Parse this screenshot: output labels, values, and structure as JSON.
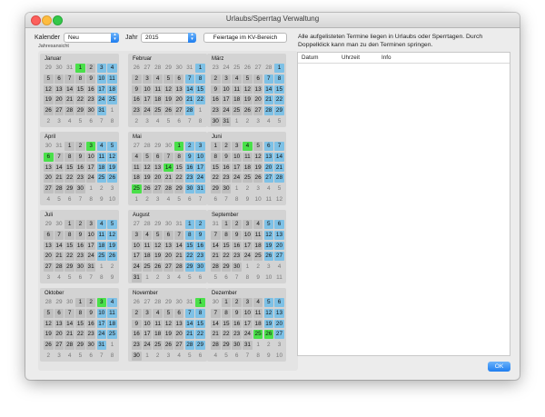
{
  "window": {
    "title": "Urlaubs/Sperrtag Verwaltung"
  },
  "toolbar": {
    "kalender_label": "Kalender",
    "kalender_value": "Neu",
    "jahr_label": "Jahr",
    "jahr_value": "2015",
    "feiertage_button": "Feiertage im KV-Bereich"
  },
  "jahresansicht_label": "Jahresansicht",
  "colors": {
    "weekend": "#7ec1e6",
    "holiday": "#4ae04a",
    "day": "#bfbfbf",
    "accent": "#1e7ef0"
  },
  "months": [
    {
      "name": "Januar",
      "weeks": [
        [
          "29",
          "30",
          "31",
          "1",
          "2",
          "3",
          "4"
        ],
        [
          "5",
          "6",
          "7",
          "8",
          "9",
          "10",
          "11"
        ],
        [
          "12",
          "13",
          "14",
          "15",
          "16",
          "17",
          "18"
        ],
        [
          "19",
          "20",
          "21",
          "22",
          "23",
          "24",
          "25"
        ],
        [
          "26",
          "27",
          "28",
          "29",
          "30",
          "31",
          "1"
        ],
        [
          "2",
          "3",
          "4",
          "5",
          "6",
          "7",
          "8"
        ]
      ],
      "holidays": [
        "1"
      ]
    },
    {
      "name": "Februar",
      "weeks": [
        [
          "26",
          "27",
          "28",
          "29",
          "30",
          "31",
          "1"
        ],
        [
          "2",
          "3",
          "4",
          "5",
          "6",
          "7",
          "8"
        ],
        [
          "9",
          "10",
          "11",
          "12",
          "13",
          "14",
          "15"
        ],
        [
          "16",
          "17",
          "18",
          "19",
          "20",
          "21",
          "22"
        ],
        [
          "23",
          "24",
          "25",
          "26",
          "27",
          "28",
          "1"
        ],
        [
          "2",
          "3",
          "4",
          "5",
          "6",
          "7",
          "8"
        ]
      ],
      "holidays": []
    },
    {
      "name": "März",
      "weeks": [
        [
          "23",
          "24",
          "25",
          "26",
          "27",
          "28",
          "1"
        ],
        [
          "2",
          "3",
          "4",
          "5",
          "6",
          "7",
          "8"
        ],
        [
          "9",
          "10",
          "11",
          "12",
          "13",
          "14",
          "15"
        ],
        [
          "16",
          "17",
          "18",
          "19",
          "20",
          "21",
          "22"
        ],
        [
          "23",
          "24",
          "25",
          "26",
          "27",
          "28",
          "29"
        ],
        [
          "30",
          "31",
          "1",
          "2",
          "3",
          "4",
          "5"
        ]
      ],
      "holidays": []
    },
    {
      "name": "April",
      "weeks": [
        [
          "30",
          "31",
          "1",
          "2",
          "3",
          "4",
          "5"
        ],
        [
          "6",
          "7",
          "8",
          "9",
          "10",
          "11",
          "12"
        ],
        [
          "13",
          "14",
          "15",
          "16",
          "17",
          "18",
          "19"
        ],
        [
          "20",
          "21",
          "22",
          "23",
          "24",
          "25",
          "26"
        ],
        [
          "27",
          "28",
          "29",
          "30",
          "1",
          "2",
          "3"
        ],
        [
          "4",
          "5",
          "6",
          "7",
          "8",
          "9",
          "10"
        ]
      ],
      "holidays": [
        "3",
        "6"
      ]
    },
    {
      "name": "Mai",
      "weeks": [
        [
          "27",
          "28",
          "29",
          "30",
          "1",
          "2",
          "3"
        ],
        [
          "4",
          "5",
          "6",
          "7",
          "8",
          "9",
          "10"
        ],
        [
          "11",
          "12",
          "13",
          "14",
          "15",
          "16",
          "17"
        ],
        [
          "18",
          "19",
          "20",
          "21",
          "22",
          "23",
          "24"
        ],
        [
          "25",
          "26",
          "27",
          "28",
          "29",
          "30",
          "31"
        ],
        [
          "1",
          "2",
          "3",
          "4",
          "5",
          "6",
          "7"
        ]
      ],
      "holidays": [
        "1",
        "14",
        "25"
      ]
    },
    {
      "name": "Juni",
      "weeks": [
        [
          "1",
          "2",
          "3",
          "4",
          "5",
          "6",
          "7"
        ],
        [
          "8",
          "9",
          "10",
          "11",
          "12",
          "13",
          "14"
        ],
        [
          "15",
          "16",
          "17",
          "18",
          "19",
          "20",
          "21"
        ],
        [
          "22",
          "23",
          "24",
          "25",
          "26",
          "27",
          "28"
        ],
        [
          "29",
          "30",
          "1",
          "2",
          "3",
          "4",
          "5"
        ],
        [
          "6",
          "7",
          "8",
          "9",
          "10",
          "11",
          "12"
        ]
      ],
      "holidays": [
        "4"
      ]
    },
    {
      "name": "Juli",
      "weeks": [
        [
          "29",
          "30",
          "1",
          "2",
          "3",
          "4",
          "5"
        ],
        [
          "6",
          "7",
          "8",
          "9",
          "10",
          "11",
          "12"
        ],
        [
          "13",
          "14",
          "15",
          "16",
          "17",
          "18",
          "19"
        ],
        [
          "20",
          "21",
          "22",
          "23",
          "24",
          "25",
          "26"
        ],
        [
          "27",
          "28",
          "29",
          "30",
          "31",
          "1",
          "2"
        ],
        [
          "3",
          "4",
          "5",
          "6",
          "7",
          "8",
          "9"
        ]
      ],
      "holidays": []
    },
    {
      "name": "August",
      "weeks": [
        [
          "27",
          "28",
          "29",
          "30",
          "31",
          "1",
          "2"
        ],
        [
          "3",
          "4",
          "5",
          "6",
          "7",
          "8",
          "9"
        ],
        [
          "10",
          "11",
          "12",
          "13",
          "14",
          "15",
          "16"
        ],
        [
          "17",
          "18",
          "19",
          "20",
          "21",
          "22",
          "23"
        ],
        [
          "24",
          "25",
          "26",
          "27",
          "28",
          "29",
          "30"
        ],
        [
          "31",
          "1",
          "2",
          "3",
          "4",
          "5",
          "6"
        ]
      ],
      "holidays": []
    },
    {
      "name": "September",
      "weeks": [
        [
          "31",
          "1",
          "2",
          "3",
          "4",
          "5",
          "6"
        ],
        [
          "7",
          "8",
          "9",
          "10",
          "11",
          "12",
          "13"
        ],
        [
          "14",
          "15",
          "16",
          "17",
          "18",
          "19",
          "20"
        ],
        [
          "21",
          "22",
          "23",
          "24",
          "25",
          "26",
          "27"
        ],
        [
          "28",
          "29",
          "30",
          "1",
          "2",
          "3",
          "4"
        ],
        [
          "5",
          "6",
          "7",
          "8",
          "9",
          "10",
          "11"
        ]
      ],
      "holidays": []
    },
    {
      "name": "Oktober",
      "weeks": [
        [
          "28",
          "29",
          "30",
          "1",
          "2",
          "3",
          "4"
        ],
        [
          "5",
          "6",
          "7",
          "8",
          "9",
          "10",
          "11"
        ],
        [
          "12",
          "13",
          "14",
          "15",
          "16",
          "17",
          "18"
        ],
        [
          "19",
          "20",
          "21",
          "22",
          "23",
          "24",
          "25"
        ],
        [
          "26",
          "27",
          "28",
          "29",
          "30",
          "31",
          "1"
        ],
        [
          "2",
          "3",
          "4",
          "5",
          "6",
          "7",
          "8"
        ]
      ],
      "holidays": [
        "3"
      ]
    },
    {
      "name": "November",
      "weeks": [
        [
          "26",
          "27",
          "28",
          "29",
          "30",
          "31",
          "1"
        ],
        [
          "2",
          "3",
          "4",
          "5",
          "6",
          "7",
          "8"
        ],
        [
          "9",
          "10",
          "11",
          "12",
          "13",
          "14",
          "15"
        ],
        [
          "16",
          "17",
          "18",
          "19",
          "20",
          "21",
          "22"
        ],
        [
          "23",
          "24",
          "25",
          "26",
          "27",
          "28",
          "29"
        ],
        [
          "30",
          "1",
          "2",
          "3",
          "4",
          "5",
          "6"
        ]
      ],
      "holidays": [
        "1"
      ]
    },
    {
      "name": "Dezember",
      "weeks": [
        [
          "30",
          "1",
          "2",
          "3",
          "4",
          "5",
          "6"
        ],
        [
          "7",
          "8",
          "9",
          "10",
          "11",
          "12",
          "13"
        ],
        [
          "14",
          "15",
          "16",
          "17",
          "18",
          "19",
          "20"
        ],
        [
          "21",
          "22",
          "23",
          "24",
          "25",
          "26",
          "27"
        ],
        [
          "28",
          "29",
          "30",
          "31",
          "1",
          "2",
          "3"
        ],
        [
          "4",
          "5",
          "6",
          "7",
          "8",
          "9",
          "10"
        ]
      ],
      "holidays": [
        "25",
        "26"
      ]
    }
  ],
  "info_text": "Alle aufgelisteten Termine liegen in Urlaubs oder Sperrtagen. Durch Doppelklick kann man zu den Terminen springen.",
  "table": {
    "columns": [
      "Datum",
      "Uhrzeit",
      "Info"
    ],
    "rows": []
  },
  "ok_button": "OK"
}
